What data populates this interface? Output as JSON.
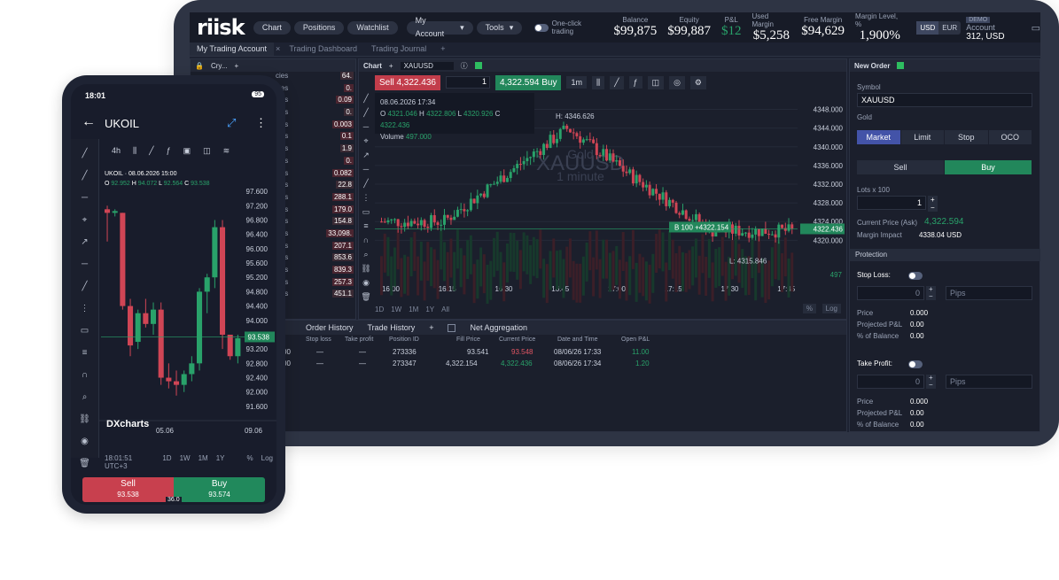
{
  "desktop": {
    "logo": "riisk",
    "menu": {
      "chart": "Chart",
      "positions": "Positions",
      "watchlist": "Watchlist",
      "my_account": "My Account",
      "tools": "Tools",
      "one_click": "One-click trading"
    },
    "stats": [
      {
        "label": "Balance",
        "value": "$99,875"
      },
      {
        "label": "Equity",
        "value": "$99,887"
      },
      {
        "label": "P&L",
        "value": "$12"
      },
      {
        "label": "Used Margin",
        "value": "$5,258"
      },
      {
        "label": "Free Margin",
        "value": "$94,629"
      },
      {
        "label": "Margin Level, %",
        "value": "1,900%"
      }
    ],
    "currency": {
      "usd": "USD",
      "eur": "EUR"
    },
    "account": {
      "badge": "DEMO",
      "label": "Account",
      "value": "312, USD"
    },
    "tabs": [
      "My Trading Account",
      "Trading Dashboard",
      "Trading Journal"
    ],
    "left_header": "Cry...",
    "left_rows": [
      "cies",
      "cies",
      "cies",
      "cies",
      "cies",
      "cies",
      "cies",
      "cies",
      "cies",
      "cies",
      "cies",
      "cies",
      "cies",
      "cies",
      "cies",
      "cies",
      "cies",
      "cies"
    ],
    "left_prices": [
      "64.",
      "0.",
      "0.09",
      "0.",
      "0.003",
      "0.1",
      "1.9",
      "0.",
      "0.082",
      "22.8",
      "288.1",
      "179.0",
      "154.8",
      "33,098.",
      "207.1",
      "853.6",
      "839.3",
      "257.3",
      "451.1"
    ],
    "chart": {
      "title": "Chart",
      "symbol": "XAUUSD",
      "sell": "Sell 4,322.436",
      "qty": "1",
      "buy": "4,322.594 Buy",
      "interval": "1m",
      "ohlc_date": "08.06.2026 17:34",
      "open": "4321.046",
      "high": "4322.806",
      "low": "4320.926",
      "close": "4322.436",
      "volume": "497.000",
      "high_label": "H: 4346.626",
      "low_label": "L: 4315.846",
      "watermark_sym": "XAUUSD",
      "watermark_name": "Gold",
      "watermark_int": "1 minute",
      "position_label": "B 100",
      "position_pnl": "+4322.154",
      "last_price": "4322.436",
      "volume_last": "497",
      "yticks": [
        "4348.000",
        "4344.000",
        "4340.000",
        "4336.000",
        "4332.000",
        "4328.000",
        "4324.000",
        "4320.000"
      ],
      "xticks": [
        "16:00",
        "16:15",
        "16:30",
        "16:45",
        "17:00",
        "17:15",
        "17:30",
        "17:45"
      ],
      "ranges": [
        "1D",
        "1W",
        "1M",
        "1Y",
        "All"
      ],
      "pct": "%",
      "log": "Log"
    },
    "order": {
      "title": "New Order",
      "symbol_label": "Symbol",
      "symbol": "XAUUSD",
      "symbol_name": "Gold",
      "types": [
        "Market",
        "Limit",
        "Stop",
        "OCO"
      ],
      "sell": "Sell",
      "buy": "Buy",
      "lots_label": "Lots x 100",
      "lots": "1",
      "price_label": "Current Price (Ask)",
      "price": "4,322.594",
      "margin_label": "Margin Impact",
      "margin": "4338.04 USD",
      "protection": "Protection",
      "stop_loss": "Stop Loss:",
      "take_profit": "Take Profit:",
      "zero": "0",
      "pips": "Pips",
      "price_row": "Price",
      "ppl_row": "Projected P&L",
      "bal_row": "% of Balance",
      "sl_price": "0.000",
      "sl_ppl": "0.00",
      "sl_bal": "0.00",
      "tp_price": "0.000",
      "tp_ppl": "0.00",
      "tp_bal": "0.00"
    },
    "history": {
      "tabs": [
        "Order History",
        "Trade History"
      ],
      "net": "Net Aggregation",
      "cols": [
        "Stop loss",
        "Take profit",
        "Position ID",
        "Fill Price",
        "Current Price",
        "Date and Time",
        "Open P&L"
      ],
      "rows": [
        {
          "pre": "00",
          "sl": "—",
          "tp": "—",
          "id": "273336",
          "fill": "93.541",
          "cur": "93.548",
          "dt": "08/06/26 17:33",
          "pnl": "11.00"
        },
        {
          "pre": "00",
          "sl": "—",
          "tp": "—",
          "id": "273347",
          "fill": "4,322.154",
          "cur": "4,322.436",
          "dt": "08/06/26 17:34",
          "pnl": "1.20"
        }
      ]
    }
  },
  "phone": {
    "time": "18:01",
    "battery": "95",
    "symbol": "UKOIL",
    "chart_info": "UKOIL · 08.06.2026 15:00",
    "o": "92.952",
    "h": "94.072",
    "l": "92.564",
    "c": "93.538",
    "interval": "4h",
    "yticks": [
      "97.600",
      "97.200",
      "96.800",
      "96.400",
      "96.000",
      "95.600",
      "95.200",
      "94.800",
      "94.400",
      "94.000",
      "93.600",
      "93.200",
      "92.800",
      "92.400",
      "92.000",
      "91.600"
    ],
    "last": "93.538",
    "brand": "DXcharts",
    "xticks": [
      "05.06",
      "09.06"
    ],
    "clock": "18:01:51 UTC+3",
    "ranges": [
      "1D",
      "1W",
      "1M",
      "1Y"
    ],
    "pct": "%",
    "log": "Log",
    "sell": "Sell",
    "sell_price": "93.538",
    "buy": "Buy",
    "buy_price": "93.574",
    "spread": "36.0"
  },
  "colors": {
    "up": "#22875b",
    "down": "#c23d4b",
    "accent": "#4353a8"
  },
  "chart_data": [
    {
      "type": "candlestick",
      "symbol": "XAUUSD",
      "x": [
        "16:00",
        "16:15",
        "16:30",
        "16:45",
        "17:00",
        "17:15",
        "17:30",
        "17:45"
      ],
      "ylim": [
        4314,
        4350
      ],
      "high": 4346.626,
      "low": 4315.846,
      "last": 4322.436
    },
    {
      "type": "candlestick",
      "symbol": "UKOIL",
      "x": [
        "05.06",
        "09.06"
      ],
      "ylim": [
        91.4,
        97.8
      ],
      "last": 93.538
    }
  ]
}
